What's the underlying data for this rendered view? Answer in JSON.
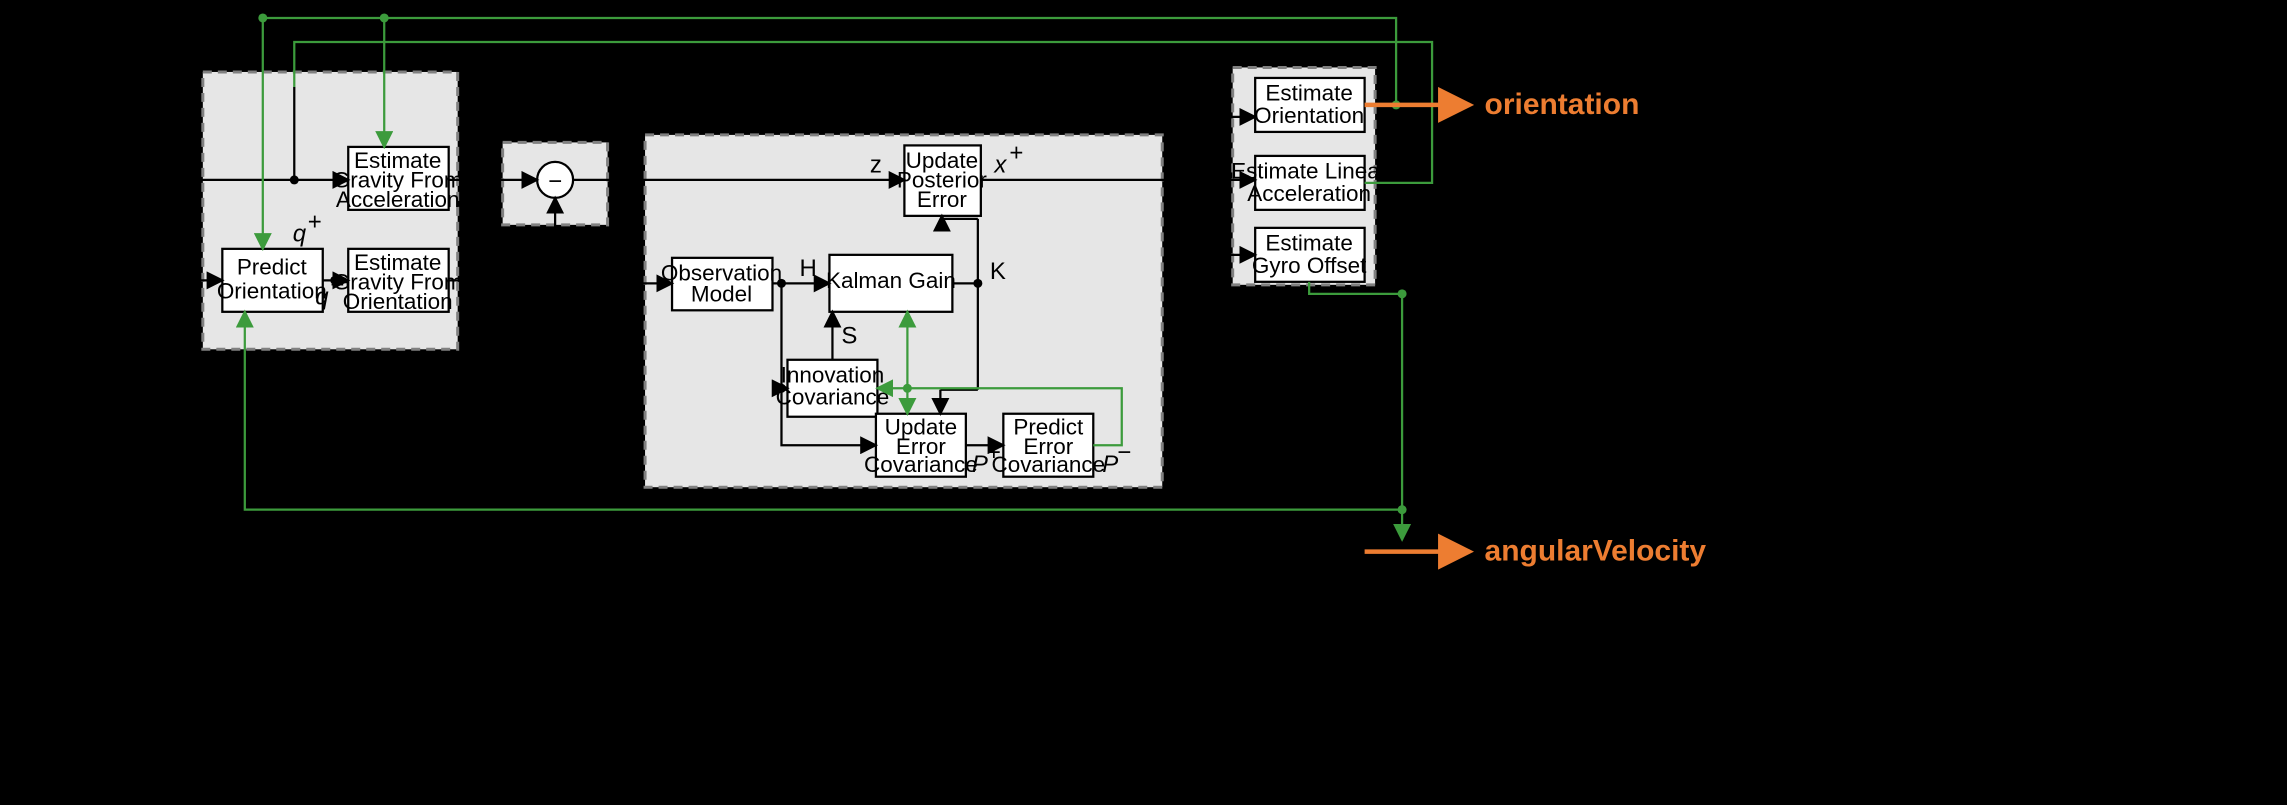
{
  "blocks": {
    "predictOrientation": {
      "l1": "Predict",
      "l2": "Orientation"
    },
    "gravAccel": {
      "l1": "Estimate",
      "l2": "Gravity From",
      "l3": "Acceleration"
    },
    "gravOrient": {
      "l1": "Estimate",
      "l2": "Gravity From",
      "l3": "Orientation"
    },
    "obsModel": {
      "l1": "Observation",
      "l2": "Model"
    },
    "kalmanGain": {
      "l1": "Kalman Gain"
    },
    "innovCov": {
      "l1": "Innovation",
      "l2": "Covariance"
    },
    "updatePostErr": {
      "l1": "Update",
      "l2": "Posterior",
      "l3": "Error"
    },
    "updateErrCov": {
      "l1": "Update",
      "l2": "Error",
      "l3": "Covariance"
    },
    "predictErrCov": {
      "l1": "Predict",
      "l2": "Error",
      "l3": "Covariance"
    },
    "estOrient": {
      "l1": "Estimate",
      "l2": "Orientation"
    },
    "estLinAcc": {
      "l1": "Estimate Linear",
      "l2": "Acceleration"
    },
    "estGyroOff": {
      "l1": "Estimate",
      "l2": "Gyro Offset"
    }
  },
  "labels": {
    "qplus": "q",
    "qminus": "q",
    "z": "z",
    "H": "H",
    "S": "S",
    "K": "K",
    "xplus": "x",
    "Pplus": "P",
    "Pminus": "P",
    "minus": "−"
  },
  "outputs": {
    "orientation": "orientation",
    "angularVelocity": "angularVelocity"
  }
}
